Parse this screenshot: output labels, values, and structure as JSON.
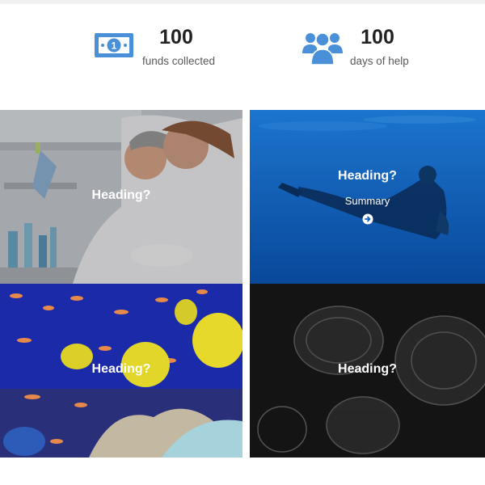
{
  "stats": [
    {
      "number": "100",
      "label": "funds collected",
      "icon": "money-bill-icon"
    },
    {
      "number": "100",
      "label": "days of help",
      "icon": "users-icon"
    }
  ],
  "tiles": [
    {
      "heading": "Heading?",
      "image": "lab-scientists"
    },
    {
      "heading": "Heading?",
      "summary": "Summary",
      "image": "scuba-diver",
      "link_icon": "arrow-circle-right-icon"
    },
    {
      "heading": "Heading?",
      "image": "coral-reef-fish"
    },
    {
      "heading": "Heading?",
      "image": "jellyfish"
    }
  ],
  "colors": {
    "accent": "#4a90d9",
    "diver_blue": "#0b63c6"
  }
}
